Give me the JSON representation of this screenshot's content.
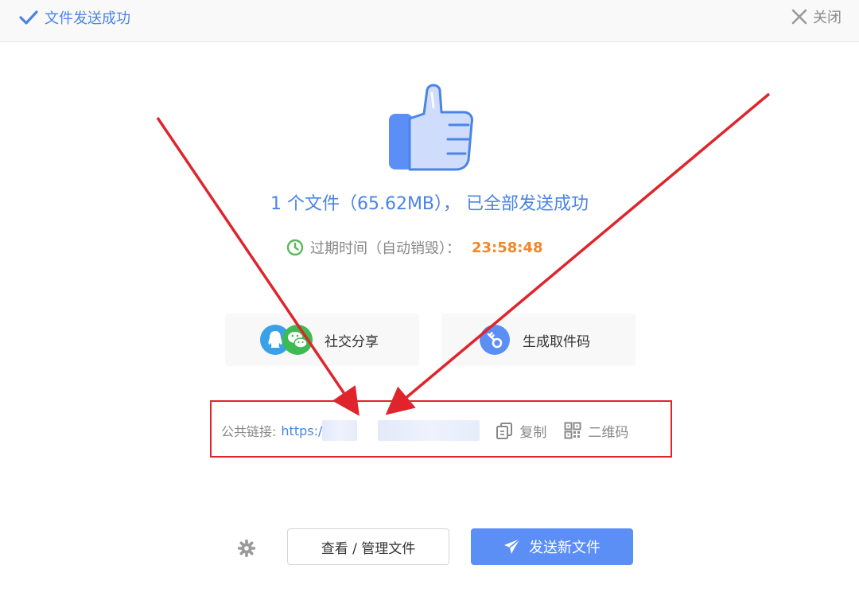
{
  "header": {
    "title": "文件发送成功",
    "close_label": "关闭"
  },
  "result": {
    "summary": "1 个文件（65.62MB）， 已全部发送成功",
    "expire_label": "过期时间（自动销毁）：",
    "expire_time": "23:58:48"
  },
  "actions": {
    "share_label": "社交分享",
    "code_label": "生成取件码"
  },
  "link": {
    "label": "公共链接:",
    "url_prefix": "https:/",
    "copy_label": "复制",
    "qr_label": "二维码"
  },
  "footer": {
    "manage_label": "查看 / 管理文件",
    "send_label": "发送新文件"
  },
  "colors": {
    "accent": "#4a84e6",
    "primary_button": "#5b8ff5",
    "timer": "#f0872a",
    "annotation": "#e0242b",
    "clock": "#5cb85c"
  },
  "icons": [
    "check-icon",
    "close-icon",
    "thumbs-up-icon",
    "clock-icon",
    "qq-icon",
    "wechat-icon",
    "key-icon",
    "copy-icon",
    "qr-code-icon",
    "gear-icon",
    "paper-plane-icon"
  ]
}
